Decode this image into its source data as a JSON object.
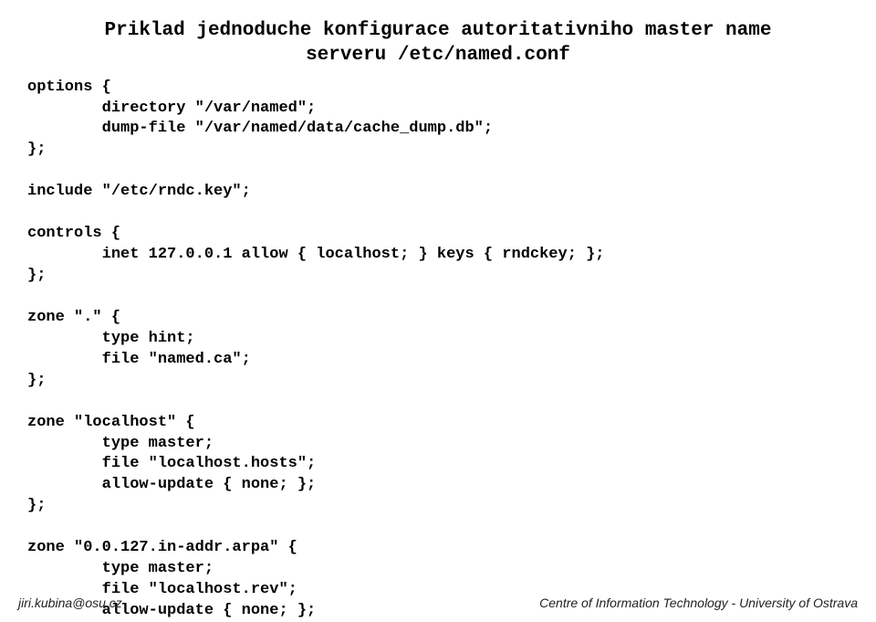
{
  "title": "Priklad jednoduche konfigurace autoritativniho master name\nserveru /etc/named.conf",
  "code": "options {\n        directory \"/var/named\";\n        dump-file \"/var/named/data/cache_dump.db\";\n};\n\ninclude \"/etc/rndc.key\";\n\ncontrols {\n        inet 127.0.0.1 allow { localhost; } keys { rndckey; };\n};\n\nzone \".\" {\n        type hint;\n        file \"named.ca\";\n};\n\nzone \"localhost\" {\n        type master;\n        file \"localhost.hosts\";\n        allow-update { none; };\n};\n\nzone \"0.0.127.in-addr.arpa\" {\n        type master;\n        file \"localhost.rev\";\n        allow-update { none; };",
  "footer": {
    "left": "jiri.kubina@osu.cz",
    "right": "Centre of Information Technology - University of Ostrava"
  }
}
